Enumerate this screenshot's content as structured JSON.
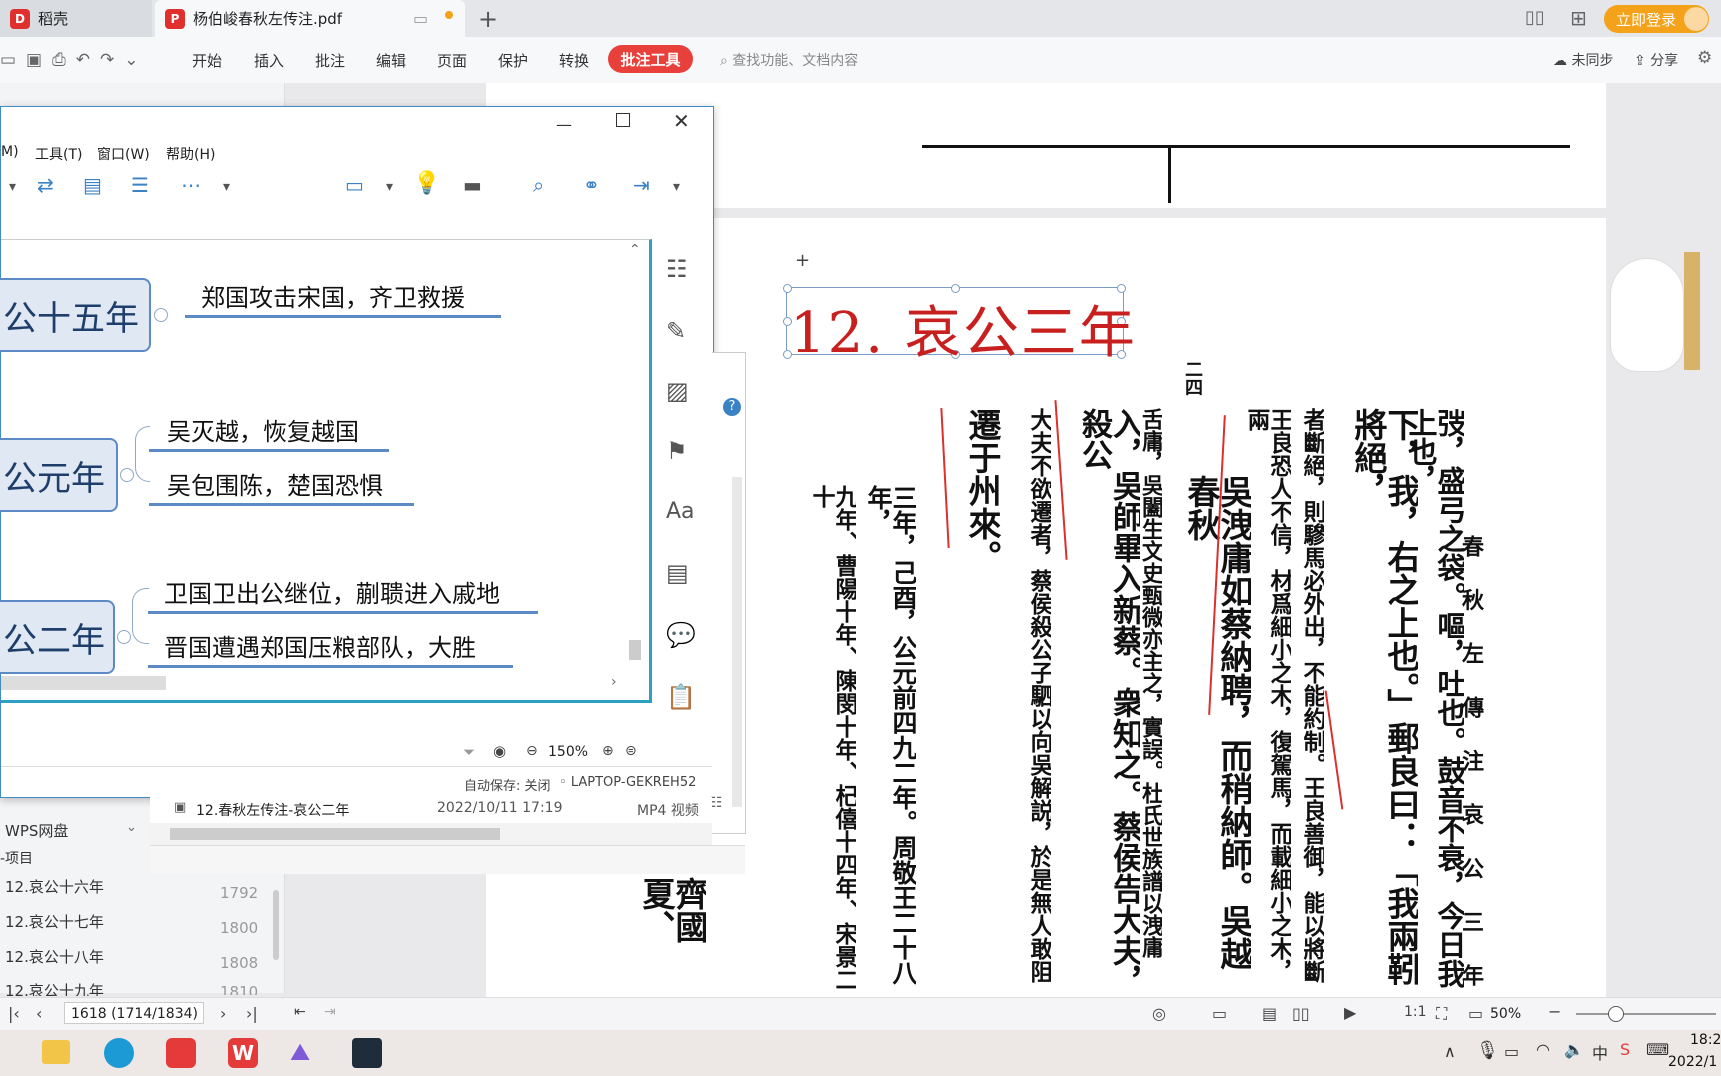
{
  "tabs": {
    "home_label": "稻壳",
    "doc_label": "杨伯峻春秋左传注.pdf",
    "new_tab": "+",
    "login_label": "立即登录"
  },
  "ribbon": {
    "menus": [
      "开始",
      "插入",
      "批注",
      "编辑",
      "页面",
      "保护",
      "转换"
    ],
    "active_menu": "批注工具",
    "search_placeholder": "查找功能、文档内容",
    "sync_label": "未同步",
    "share_label": "分享"
  },
  "mindmap_window": {
    "menubar": [
      "M)",
      "工具(T)",
      "窗口(W)",
      "帮助(H)"
    ],
    "nodes": [
      {
        "label": "公十五年",
        "leaves": [
          "郑国攻击宋国，齐卫救援"
        ]
      },
      {
        "label": "公元年",
        "leaves": [
          "吴灭越，恢复越国",
          "吴包围陈，楚国恐惧"
        ]
      },
      {
        "label": "公二年",
        "leaves": [
          "卫国卫出公继位，蒯聩进入戚地",
          "晋国遭遇郑国压粮部队，大胜"
        ]
      }
    ],
    "zoom_label": "150%",
    "autosave_label": "自动保存: 关闭",
    "device_label": "LAPTOP-GEKREH52"
  },
  "file_row": {
    "name": "12.春秋左传注-哀公二年",
    "date": "2022/10/11 17:19",
    "type": "MP4 视频"
  },
  "left_panel": {
    "wps_drive": "WPS网盘",
    "project": "-项目",
    "items": [
      {
        "label": "12.哀公十六年",
        "page": "1792"
      },
      {
        "label": "12.哀公十七年",
        "page": "1800"
      },
      {
        "label": "12.哀公十八年",
        "page": "1808"
      },
      {
        "label": "12.哀公十九年",
        "page": "1810"
      }
    ]
  },
  "document": {
    "annotation_title": "12. 哀公三年",
    "page_header": "春 秋 左 傳 注   哀 公   三 年",
    "columns": [
      "弢，盛弓之袋。嘔，吐也。鼓音不衰，今日我上也，",
      "下，我，右之上也。」郵良曰：「我兩靷將絕，",
      "者斷絕，則驂馬必外出，不能約制。王良善御，能以將斷",
      "王良恐人不信，材爲細小之木，復駕馬，而載細小之木，兩",
      "吳洩庸如蔡納聘，而稍納師。吳越春秋",
      "舌庸，吳闔生文史甄微亦主之，實誤。杜氏世族譜以洩庸",
      "入，吳師畢入新蔡。衆知之。蔡侯告大夫，殺公",
      "大夫不欲遷者，蔡侯殺公子駟以向吳解説，於是無人敢阻",
      "遷于州來。",
      "三年，己酉，公元前四九二年。周敬王二十八年，",
      "九年、曹陽十年、陳閔十年、杞僖十四年、宋景二十",
      "齊國夏、"
    ],
    "page_marker": "二四"
  },
  "statusbar": {
    "page_indicator": "1618 (1714/1834)",
    "zoom": "50%"
  },
  "taskbar": {
    "time": "18:2",
    "date": "2022/1"
  }
}
